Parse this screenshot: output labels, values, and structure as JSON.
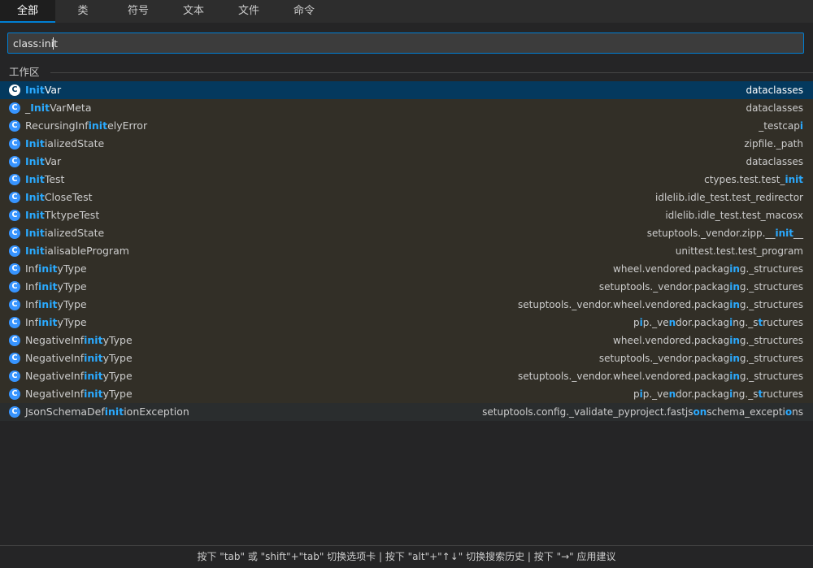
{
  "tabs": [
    "全部",
    "类",
    "符号",
    "文本",
    "文件",
    "命令"
  ],
  "active_tab": 0,
  "search": {
    "value": "class:init",
    "placeholder": ""
  },
  "section_label": "工作区",
  "results": [
    {
      "name": [
        {
          "t": "Init",
          "h": true
        },
        {
          "t": "Var"
        }
      ],
      "path": [
        {
          "t": "dataclasses"
        }
      ],
      "selected": true
    },
    {
      "name": [
        {
          "t": "_"
        },
        {
          "t": "Init",
          "h": true
        },
        {
          "t": "VarMeta"
        }
      ],
      "path": [
        {
          "t": "dataclasses"
        }
      ]
    },
    {
      "name": [
        {
          "t": "RecursingInf"
        },
        {
          "t": "init",
          "h": true
        },
        {
          "t": "elyError"
        }
      ],
      "path": [
        {
          "t": "_testcap"
        },
        {
          "t": "i",
          "h": true
        }
      ]
    },
    {
      "name": [
        {
          "t": "Init",
          "h": true
        },
        {
          "t": "ializedState"
        }
      ],
      "path": [
        {
          "t": "zipfile._path"
        }
      ]
    },
    {
      "name": [
        {
          "t": "Init",
          "h": true
        },
        {
          "t": "Var"
        }
      ],
      "path": [
        {
          "t": "dataclasses"
        }
      ]
    },
    {
      "name": [
        {
          "t": "Init",
          "h": true
        },
        {
          "t": "Test"
        }
      ],
      "path": [
        {
          "t": "ctypes.test.test_"
        },
        {
          "t": "init",
          "h": true
        }
      ]
    },
    {
      "name": [
        {
          "t": "Init",
          "h": true
        },
        {
          "t": "CloseTest"
        }
      ],
      "path": [
        {
          "t": "idlelib.idle_test.test_redirector"
        }
      ]
    },
    {
      "name": [
        {
          "t": "Init",
          "h": true
        },
        {
          "t": "TktypeTest"
        }
      ],
      "path": [
        {
          "t": "idlelib.idle_test.test_macosx"
        }
      ]
    },
    {
      "name": [
        {
          "t": "Init",
          "h": true
        },
        {
          "t": "ializedState"
        }
      ],
      "path": [
        {
          "t": "setuptools._vendor.zipp.__"
        },
        {
          "t": "init",
          "h": true
        },
        {
          "t": "__"
        }
      ]
    },
    {
      "name": [
        {
          "t": "Init",
          "h": true
        },
        {
          "t": "ialisableProgram"
        }
      ],
      "path": [
        {
          "t": "unittest.test.test_program"
        }
      ]
    },
    {
      "name": [
        {
          "t": "Inf"
        },
        {
          "t": "init",
          "h": true
        },
        {
          "t": "yType"
        }
      ],
      "path": [
        {
          "t": "wheel.vendored.packag"
        },
        {
          "t": "in",
          "h": true
        },
        {
          "t": "g._structures"
        }
      ]
    },
    {
      "name": [
        {
          "t": "Inf"
        },
        {
          "t": "init",
          "h": true
        },
        {
          "t": "yType"
        }
      ],
      "path": [
        {
          "t": "setuptools._vendor.packag"
        },
        {
          "t": "in",
          "h": true
        },
        {
          "t": "g._structures"
        }
      ]
    },
    {
      "name": [
        {
          "t": "Inf"
        },
        {
          "t": "init",
          "h": true
        },
        {
          "t": "yType"
        }
      ],
      "path": [
        {
          "t": "setuptools._vendor.wheel.vendored.packag"
        },
        {
          "t": "in",
          "h": true
        },
        {
          "t": "g._structures"
        }
      ]
    },
    {
      "name": [
        {
          "t": "Inf"
        },
        {
          "t": "init",
          "h": true
        },
        {
          "t": "yType"
        }
      ],
      "path": [
        {
          "t": "p"
        },
        {
          "t": "i",
          "h": true
        },
        {
          "t": "p._ve"
        },
        {
          "t": "n",
          "h": true
        },
        {
          "t": "dor.packag"
        },
        {
          "t": "i",
          "h": true
        },
        {
          "t": "ng._s"
        },
        {
          "t": "t",
          "h": true
        },
        {
          "t": "ructures"
        }
      ]
    },
    {
      "name": [
        {
          "t": "NegativeInf"
        },
        {
          "t": "init",
          "h": true
        },
        {
          "t": "yType"
        }
      ],
      "path": [
        {
          "t": "wheel.vendored.packag"
        },
        {
          "t": "in",
          "h": true
        },
        {
          "t": "g._structures"
        }
      ]
    },
    {
      "name": [
        {
          "t": "NegativeInf"
        },
        {
          "t": "init",
          "h": true
        },
        {
          "t": "yType"
        }
      ],
      "path": [
        {
          "t": "setuptools._vendor.packag"
        },
        {
          "t": "in",
          "h": true
        },
        {
          "t": "g._structures"
        }
      ]
    },
    {
      "name": [
        {
          "t": "NegativeInf"
        },
        {
          "t": "init",
          "h": true
        },
        {
          "t": "yType"
        }
      ],
      "path": [
        {
          "t": "setuptools._vendor.wheel.vendored.packag"
        },
        {
          "t": "in",
          "h": true
        },
        {
          "t": "g._structures"
        }
      ]
    },
    {
      "name": [
        {
          "t": "NegativeInf"
        },
        {
          "t": "init",
          "h": true
        },
        {
          "t": "yType"
        }
      ],
      "path": [
        {
          "t": "p"
        },
        {
          "t": "i",
          "h": true
        },
        {
          "t": "p._ve"
        },
        {
          "t": "n",
          "h": true
        },
        {
          "t": "dor.packag"
        },
        {
          "t": "i",
          "h": true
        },
        {
          "t": "ng._s"
        },
        {
          "t": "t",
          "h": true
        },
        {
          "t": "ructures"
        }
      ]
    },
    {
      "name": [
        {
          "t": "JsonSchemaDef"
        },
        {
          "t": "init",
          "h": true
        },
        {
          "t": "ionException"
        }
      ],
      "path": [
        {
          "t": "setuptools.config._validate_pyproject.fastjs"
        },
        {
          "t": "on",
          "h": true
        },
        {
          "t": "schema_excepti"
        },
        {
          "t": "o",
          "h": true
        },
        {
          "t": "ns"
        }
      ],
      "plain": true
    }
  ],
  "icon_letter": "C",
  "footer": "按下 \"tab\" 或 \"shift\"+\"tab\" 切换选项卡 | 按下 \"alt\"+\"↑↓\" 切换搜索历史 | 按下 \"→\" 应用建议",
  "colors": {
    "accent": "#007fd4",
    "highlight": "#2aaaff",
    "selected_row": "#04395e",
    "result_row": "#322f27",
    "icon": "#3794ff"
  }
}
